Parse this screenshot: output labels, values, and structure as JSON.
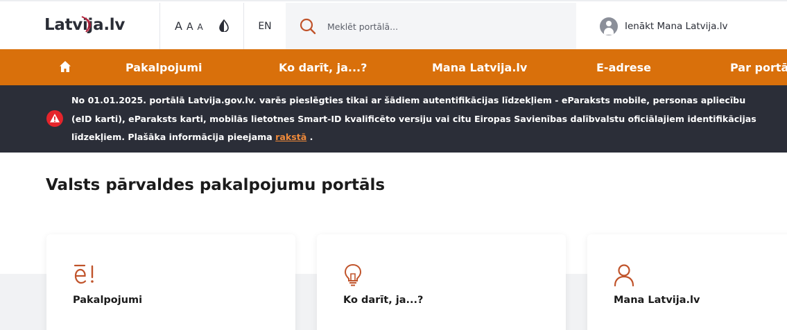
{
  "header": {
    "logo_text": "Latvija.lv",
    "font_sizes": [
      "A",
      "A",
      "A"
    ],
    "language": "EN",
    "search": {
      "placeholder": "Meklēt portālā..."
    },
    "login_label": "Ienākt Mana Latvija.lv"
  },
  "nav": {
    "items": [
      {
        "label": "Pakalpojumi"
      },
      {
        "label": "Ko darīt, ja...?"
      },
      {
        "label": "Mana Latvija.lv"
      },
      {
        "label": "E-adrese"
      },
      {
        "label": "Par portālu"
      }
    ]
  },
  "alert": {
    "text": "No 01.01.2025. portālā Latvija.gov.lv. varēs pieslēgties tikai ar šādiem autentifikācijas līdzekļiem - eParaksts mobile, personas apliecību (eID karti), eParaksts karti, mobilās lietotnes Smart-ID kvalificēto versiju vai citu Eiropas Savienības dalībvalstu oficiālajiem identifikācijas līdzekļiem. Plašāka informācija pieejama",
    "link_text": "rakstā",
    "suffix": "."
  },
  "main": {
    "title": "Valsts pārvaldes pakalpojumu portāls",
    "cards": [
      {
        "title": "Pakalpojumi",
        "icon": "e-services-icon"
      },
      {
        "title": "Ko darīt, ja...?",
        "icon": "lightbulb-icon"
      },
      {
        "title": "Mana Latvija.lv",
        "icon": "user-icon"
      }
    ]
  },
  "colors": {
    "accent": "#d9700b",
    "alert_bg": "#2b2e38",
    "icon_accent": "#c0532a",
    "link": "#f08a3a"
  }
}
